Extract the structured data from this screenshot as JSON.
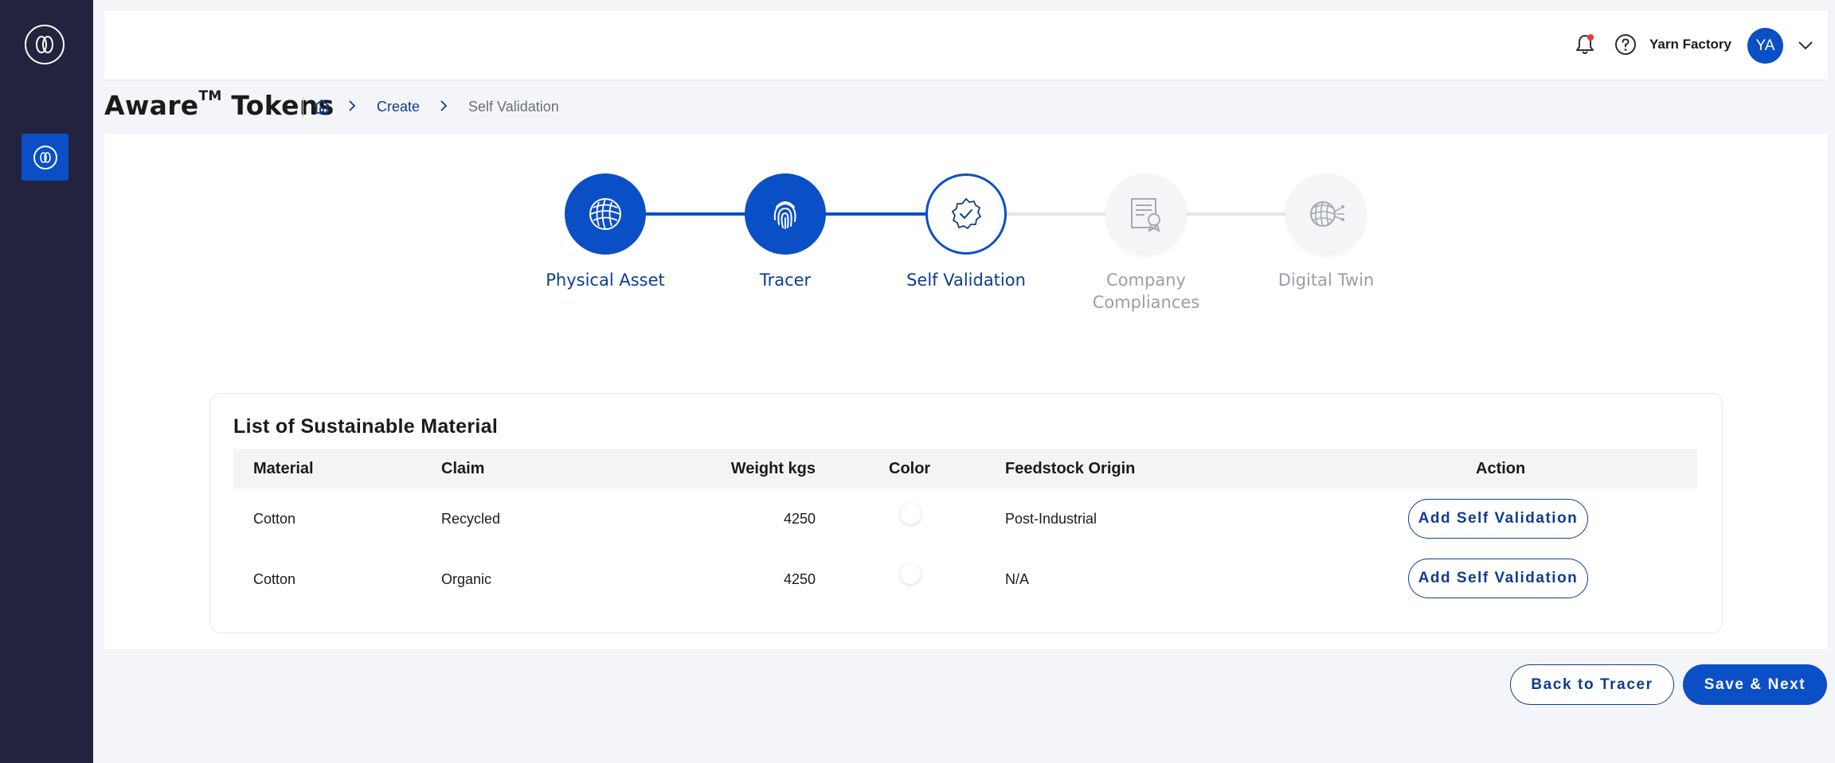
{
  "app": {
    "title": "Aware",
    "title_mark": "TM",
    "title_suffix": "Tokens"
  },
  "header": {
    "company_name": "Yarn Factory",
    "avatar_initials": "YA",
    "notification_icon": "bell-icon",
    "help_icon": "help-circle-icon"
  },
  "breadcrumb": {
    "home_icon": "home-icon",
    "items": [
      "Create",
      "Self Validation"
    ]
  },
  "stepper": {
    "steps": [
      {
        "label": "Physical Asset",
        "state": "done",
        "icon": "yarn-ball-icon"
      },
      {
        "label": "Tracer",
        "state": "done",
        "icon": "fingerprint-icon"
      },
      {
        "label": "Self Validation",
        "state": "current",
        "icon": "badge-check-icon"
      },
      {
        "label": "Company Compliances",
        "state": "future",
        "icon": "certificate-icon"
      },
      {
        "label": "Digital Twin",
        "state": "future",
        "icon": "digital-twin-icon"
      }
    ]
  },
  "materials": {
    "title": "List of Sustainable Material",
    "columns": [
      "Material",
      "Claim",
      "Weight kgs",
      "Color",
      "Feedstock Origin",
      "Action"
    ],
    "rows": [
      {
        "material": "Cotton",
        "claim": "Recycled",
        "weight": "4250",
        "color": "#ffffff",
        "origin": "Post-Industrial",
        "action": "Add Self Validation"
      },
      {
        "material": "Cotton",
        "claim": "Organic",
        "weight": "4250",
        "color": "#ffffff",
        "origin": "N/A",
        "action": "Add Self Validation"
      }
    ]
  },
  "footer": {
    "back_label": "Back to Tracer",
    "next_label": "Save & Next"
  },
  "colors": {
    "primary": "#0b4fc7",
    "sidebar": "#232340",
    "text_dark_blue": "#0d3d8f",
    "notification_dot": "#e53935"
  }
}
